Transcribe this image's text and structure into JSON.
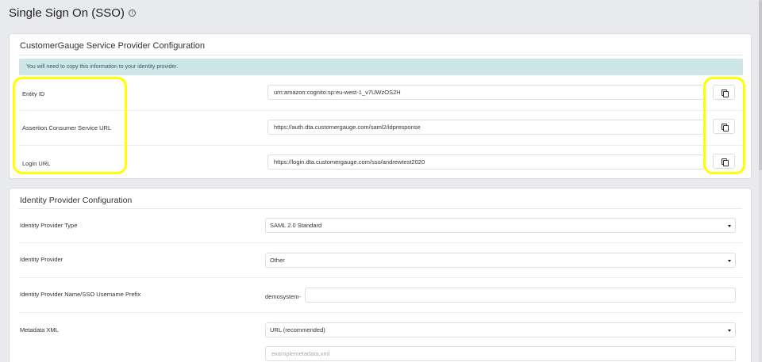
{
  "page": {
    "title": "Single Sign On (SSO)",
    "info_icon": "info-icon"
  },
  "sp_config": {
    "title": "CustomerGauge Service Provider Configuration",
    "notice": "You will need to copy this information to your identity provider.",
    "rows": [
      {
        "label": "Entity ID",
        "value": "urn:amazon:cognito:sp:eu-west-1_v7UWzOS2H",
        "icon": "copy-icon"
      },
      {
        "label": "Assertion Consumer Service URL",
        "value": "https://auth.dta.customergauge.com/saml2/idpresponse",
        "icon": "copy-icon"
      },
      {
        "label": "Login URL",
        "value": "https://login.dta.customergauge.com/sso/andrewtest2020",
        "icon": "copy-icon"
      }
    ]
  },
  "idp_config": {
    "title": "Identity Provider Configuration",
    "type_label": "Identity Provider Type",
    "type_value": "SAML 2.0 Standard",
    "provider_label": "Identity Provider",
    "provider_value": "Other",
    "prefix_label": "Identity Provider Name/SSO Username Prefix",
    "prefix_text": "demosystem-",
    "prefix_value": "",
    "metadata_label": "Metadata XML",
    "metadata_value": "URL (recommended)",
    "metadata_placeholder": "examplemetadata.xml"
  },
  "colors": {
    "highlight": "#ffff00",
    "notice_bg": "#cde6e8",
    "page_bg": "#e9eaed"
  }
}
